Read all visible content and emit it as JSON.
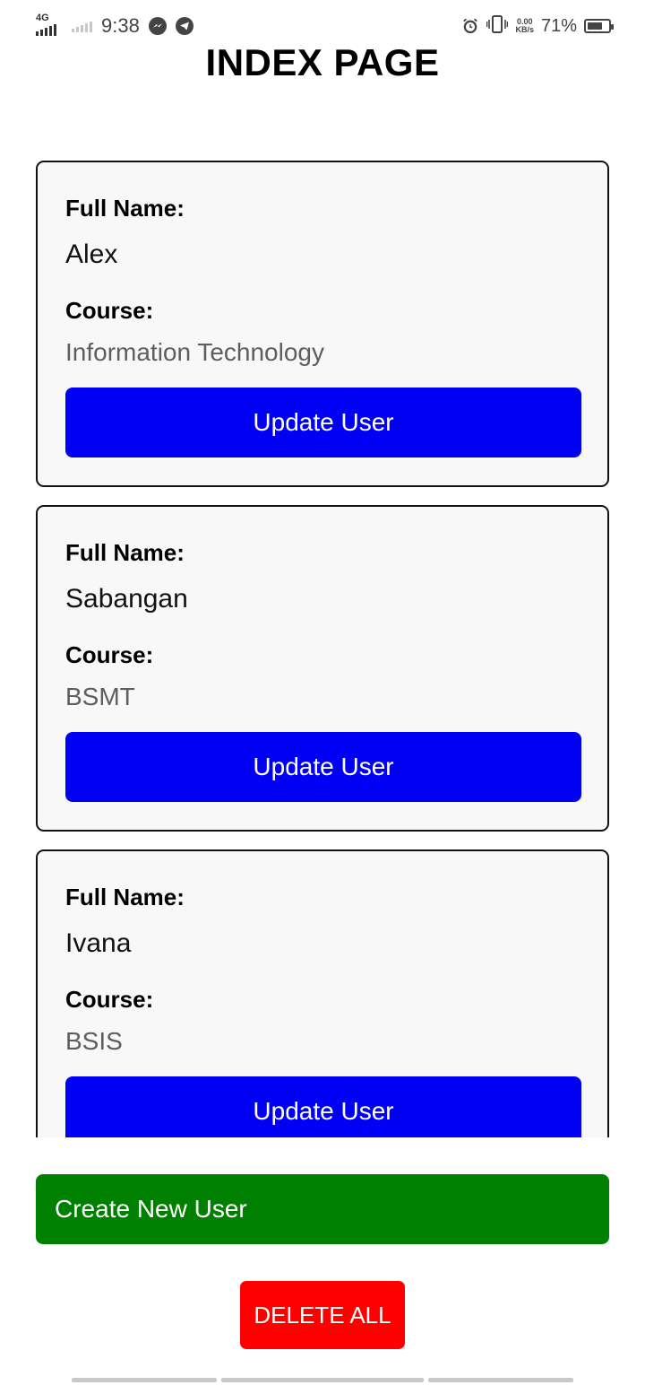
{
  "status_bar": {
    "network": "4G",
    "time": "9:38",
    "speed_value": "0.00",
    "speed_unit": "KB/s",
    "battery_percent": "71%",
    "battery_level": 0.71,
    "icons": [
      "messenger-icon",
      "telegram-icon",
      "alarm-icon",
      "vibrate-icon",
      "battery-icon"
    ]
  },
  "title": "INDEX PAGE",
  "users": [
    {
      "full_name_label": "Full Name:",
      "full_name": "Alex",
      "course_label": "Course:",
      "course": "Information Technology",
      "update_label": "Update User"
    },
    {
      "full_name_label": "Full Name:",
      "full_name": "Sabangan",
      "course_label": "Course:",
      "course": "BSMT",
      "update_label": "Update User"
    },
    {
      "full_name_label": "Full Name:",
      "full_name": "Ivana",
      "course_label": "Course:",
      "course": "BSIS",
      "update_label": "Update User"
    }
  ],
  "actions": {
    "create_label": "Create New User",
    "delete_label": "DELETE ALL"
  },
  "colors": {
    "update_button": "#0000f5",
    "create_button": "#008000",
    "delete_button": "#ff0000",
    "card_background": "#f8f8f8"
  }
}
